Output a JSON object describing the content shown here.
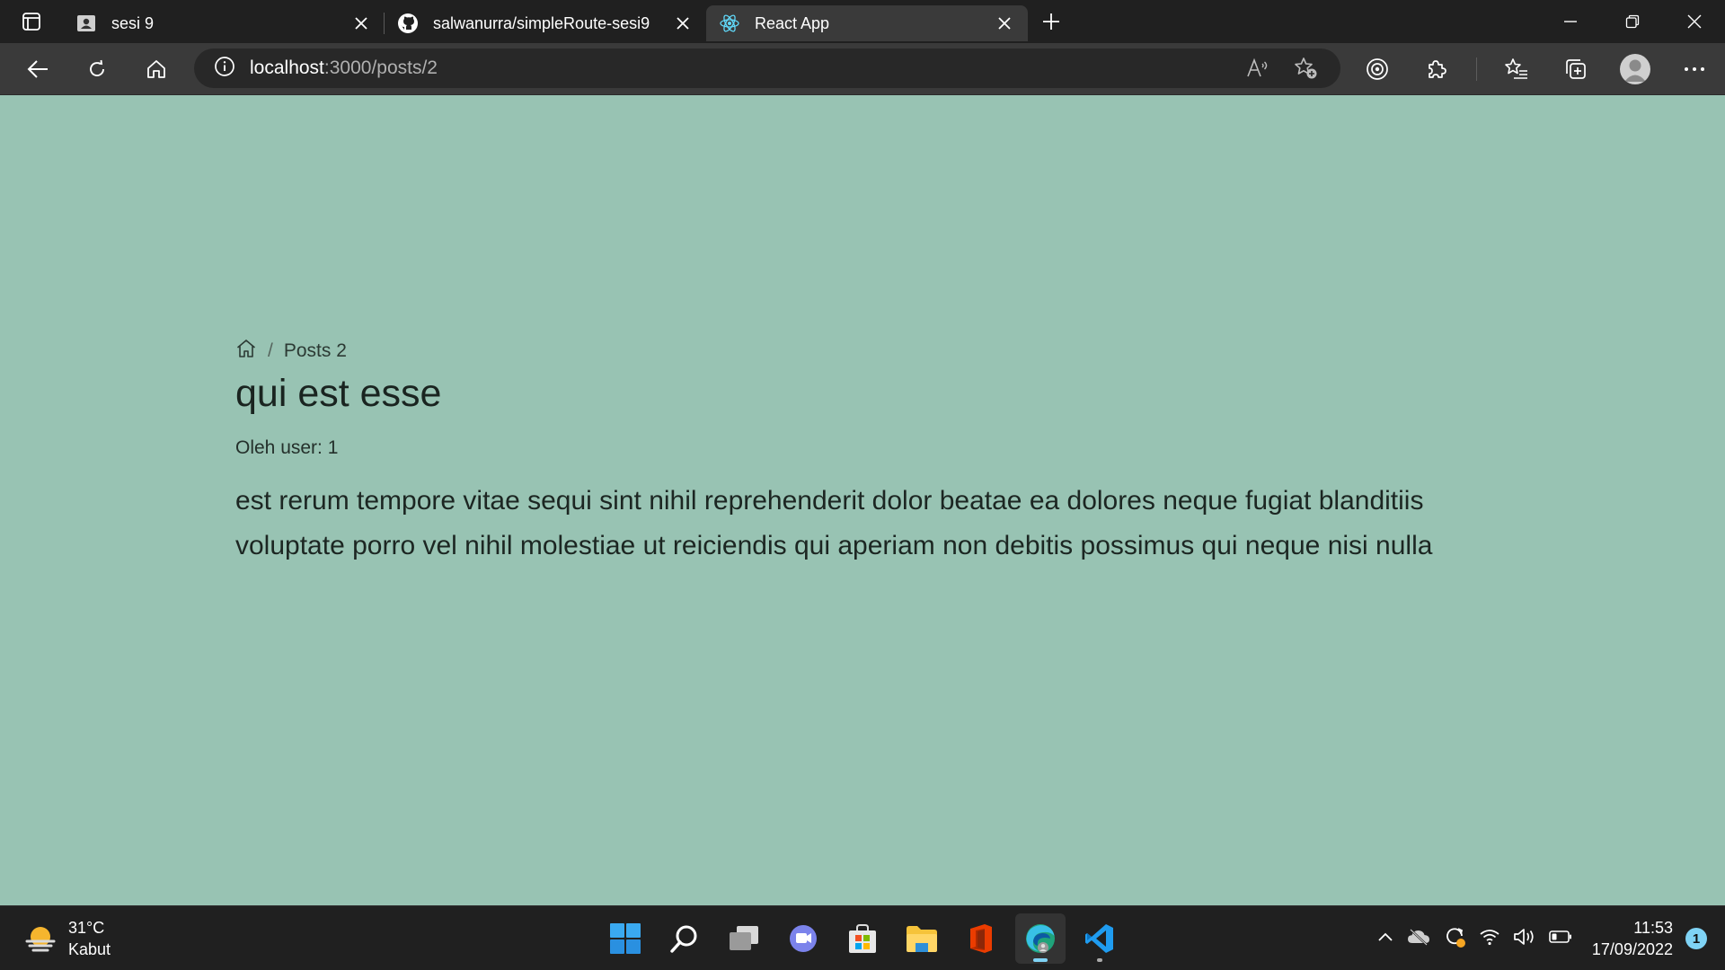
{
  "tabs": [
    {
      "title": "sesi 9",
      "favicon": "profile-card-icon",
      "active": false
    },
    {
      "title": "salwanurra/simpleRoute-sesi9",
      "favicon": "github-icon",
      "active": false
    },
    {
      "title": "React App",
      "favicon": "react-icon",
      "active": true
    }
  ],
  "address_bar": {
    "host": "localhost",
    "path": ":3000/posts/2"
  },
  "breadcrumb": {
    "current": "Posts 2"
  },
  "post": {
    "title": "qui est esse",
    "author": "Oleh user: 1",
    "body": "est rerum tempore vitae sequi sint nihil reprehenderit dolor beatae ea dolores neque fugiat blanditiis voluptate porro vel nihil molestiae ut reiciendis qui aperiam non debitis possimus qui neque nisi nulla"
  },
  "taskbar": {
    "weather": {
      "temp": "31°C",
      "condition": "Kabut"
    },
    "time": "11:53",
    "date": "17/09/2022",
    "notifications": "1"
  },
  "colors": {
    "page_bg": "#98c3b3",
    "chrome_dark": "#202020",
    "toolbar": "#3a3a3a",
    "accent": "#7fd3f5"
  }
}
